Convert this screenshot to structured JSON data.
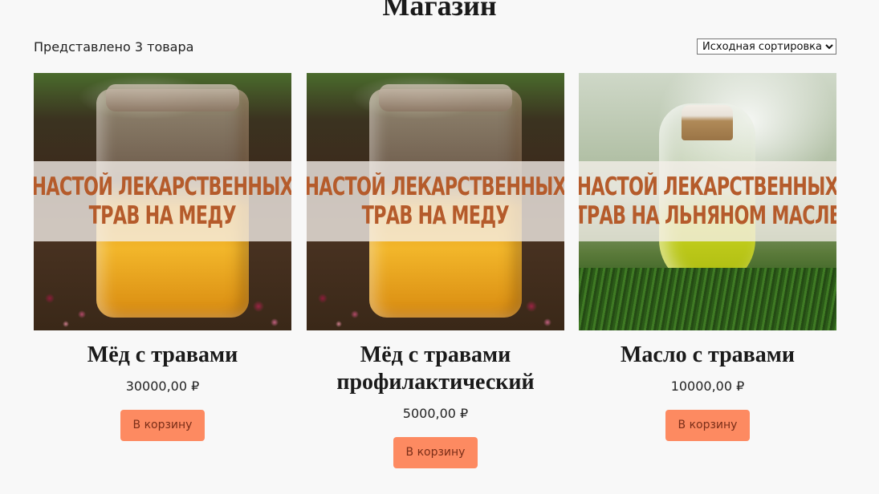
{
  "page": {
    "title": "Магазин",
    "result_count": "Представлено 3 товара",
    "sort": {
      "selected": "Исходная сортировка"
    }
  },
  "products": [
    {
      "banner_line1": "НАСТОЙ ЛЕКАРСТВЕННЫХ",
      "banner_line2": "ТРАВ НА МЕДУ",
      "title": "Мёд с травами",
      "price": "30000,00 ₽",
      "button": "В корзину"
    },
    {
      "banner_line1": "НАСТОЙ ЛЕКАРСТВЕННЫХ",
      "banner_line2": "ТРАВ НА МЕДУ",
      "title": "Мёд с травами профилактический",
      "price": "5000,00 ₽",
      "button": "В корзину"
    },
    {
      "banner_line1": "НАСТОЙ ЛЕКАРСТВЕННЫХ",
      "banner_line2": "ТРАВ НА ЛЬНЯНОМ МАСЛЕ",
      "title": "Масло с травами",
      "price": "10000,00 ₽",
      "button": "В корзину"
    }
  ],
  "colors": {
    "button_bg": "#fd8a61",
    "banner_text": "#b55b2b",
    "page_bg": "#f8f8f8"
  }
}
